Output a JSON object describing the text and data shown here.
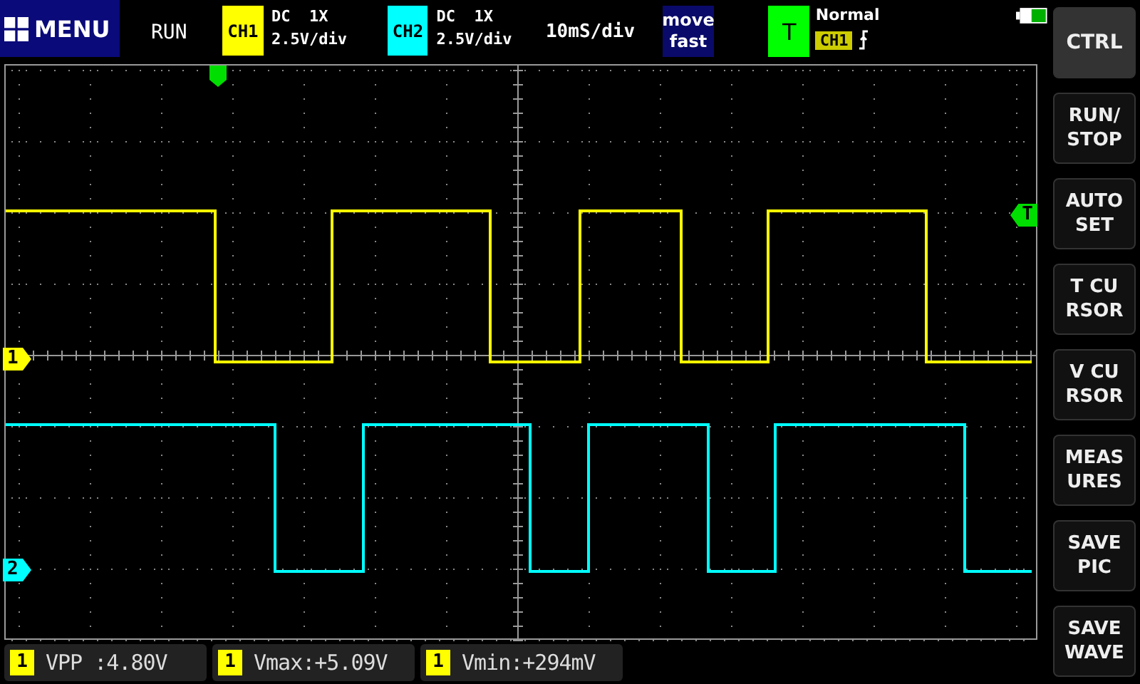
{
  "menu_button": {
    "label": "MENU"
  },
  "run_state": "RUN",
  "channels": [
    {
      "badge": "CH1",
      "coupling": "DC  1X",
      "scale": "2.5V/div",
      "marker": "1",
      "color": "#ffff00"
    },
    {
      "badge": "CH2",
      "coupling": "DC  1X",
      "scale": "2.5V/div",
      "marker": "2",
      "color": "#00ffff"
    }
  ],
  "timebase": "10mS/div",
  "move_mode": "move fast",
  "trigger": {
    "badge": "T",
    "mode": "Normal",
    "source": "CH1",
    "level_marker": "T"
  },
  "side_buttons": [
    {
      "label": "CTRL"
    },
    {
      "label": "RUN/\nSTOP"
    },
    {
      "label": "AUTO\nSET"
    },
    {
      "label": "T  CU\nRSOR"
    },
    {
      "label": "V  CU\nRSOR"
    },
    {
      "label": "MEAS\nURES"
    },
    {
      "label": "SAVE\nPIC"
    },
    {
      "label": "SAVE\nWAVE"
    }
  ],
  "measurements": [
    {
      "channel": "1",
      "text": "VPP :4.80V"
    },
    {
      "channel": "1",
      "text": "Vmax:+5.09V"
    },
    {
      "channel": "1",
      "text": "Vmin:+294mV"
    }
  ]
}
